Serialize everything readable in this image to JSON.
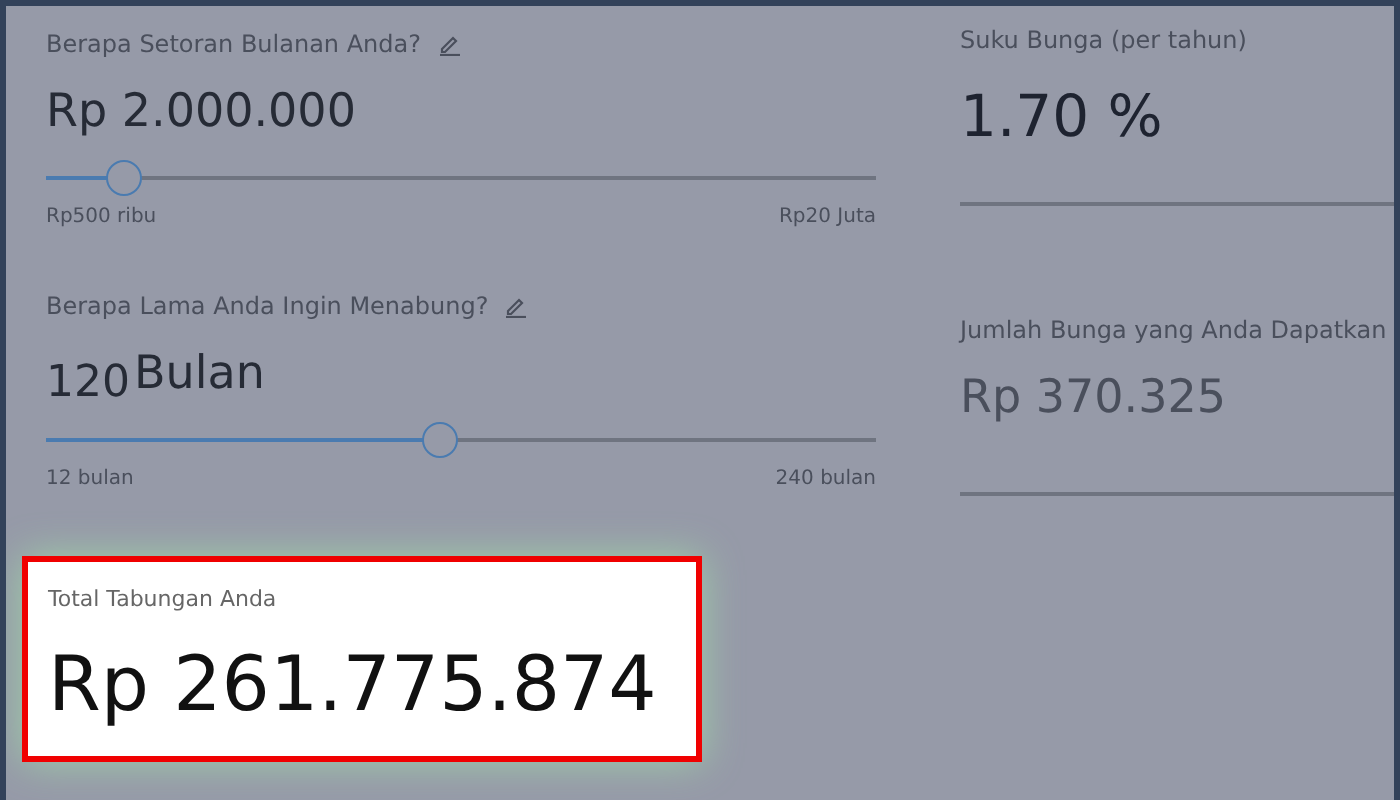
{
  "savings_inputs": [
    {
      "kind": "amount",
      "label": "Berapa Setoran Bulanan Anda?",
      "value": "Rp 2.000.000",
      "level": 0.094,
      "min_label": "Rp500 ribu",
      "max_label": "Rp20 Juta"
    },
    {
      "kind": "duration",
      "label": "Berapa Lama Anda Ingin Menabung?",
      "value": "120",
      "unit": "Bulan",
      "level": 0.475,
      "min_label": "12 bulan",
      "max_label": "240 bulan"
    }
  ],
  "results": [
    {
      "kind": "rate",
      "label": "Suku Bunga (per tahun)",
      "value": "1.70 %"
    },
    {
      "kind": "interest",
      "label": "Jumlah Bunga yang Anda Dapatkan",
      "value": "Rp 370.325"
    }
  ],
  "total": {
    "label": "Total Tabungan Anda",
    "value": "Rp 261.775.874",
    "highlighted": true
  }
}
